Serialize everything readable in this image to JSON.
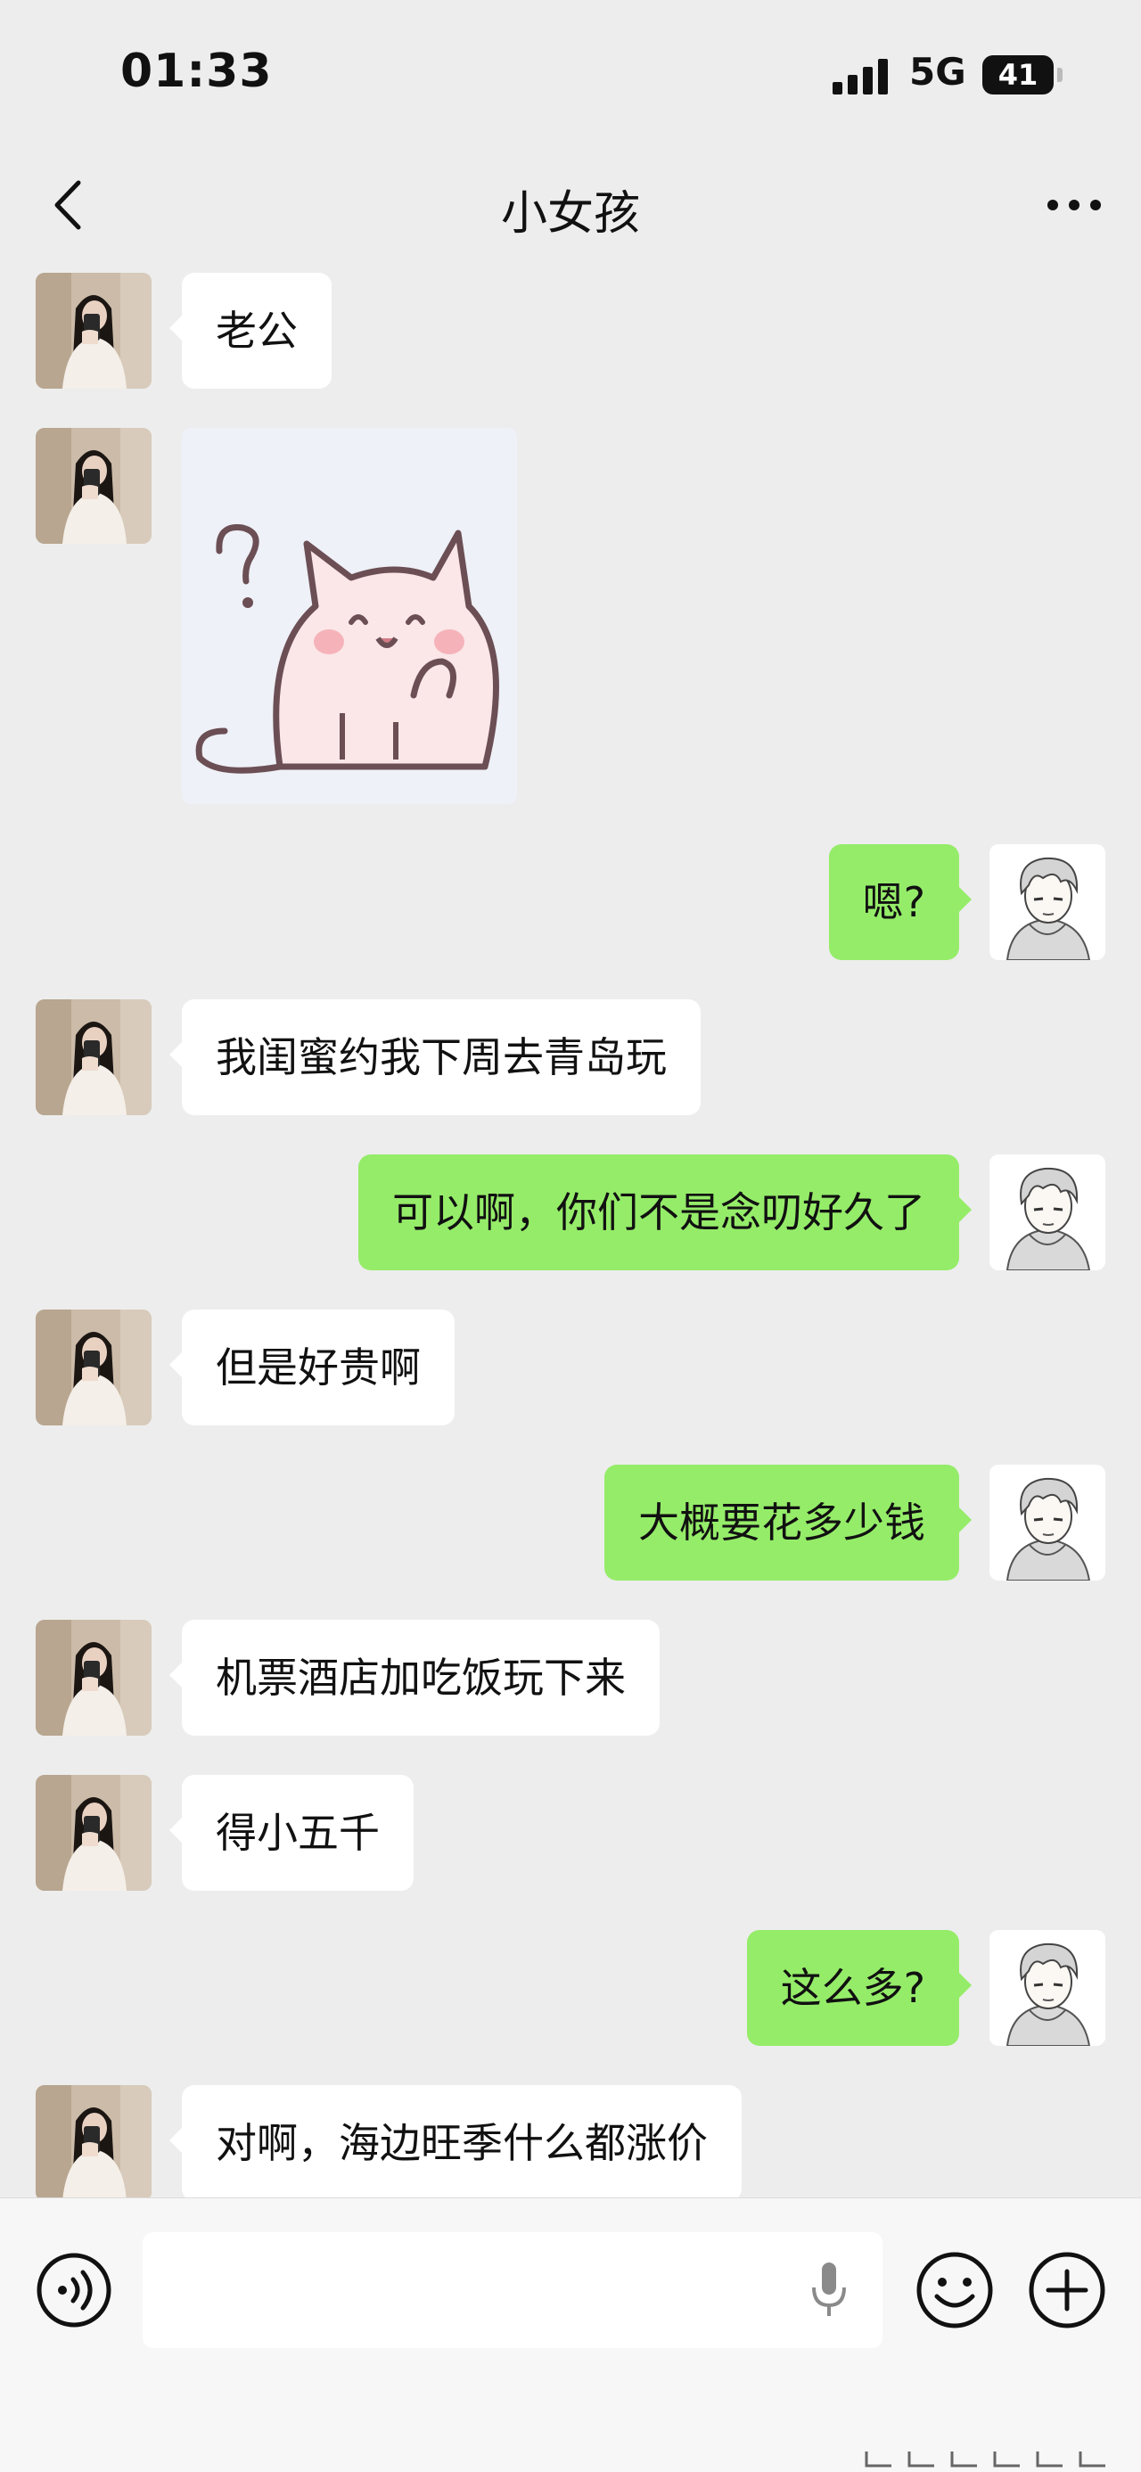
{
  "status": {
    "time": "01:33",
    "network": "5G",
    "battery": "41"
  },
  "header": {
    "title": "小女孩"
  },
  "messages": [
    {
      "side": "in",
      "text": "老公"
    },
    {
      "side": "in",
      "type": "sticker",
      "icon": "cat-question-sticker"
    },
    {
      "side": "out",
      "text": "嗯?"
    },
    {
      "side": "in",
      "text": "我闺蜜约我下周去青岛玩"
    },
    {
      "side": "out",
      "text": "可以啊，你们不是念叨好久了"
    },
    {
      "side": "in",
      "text": "但是好贵啊"
    },
    {
      "side": "out",
      "text": "大概要花多少钱"
    },
    {
      "side": "in",
      "text": "机票酒店加吃饭玩下来"
    },
    {
      "side": "in",
      "text": "得小五千"
    },
    {
      "side": "out",
      "text": "这么多?"
    },
    {
      "side": "in",
      "text": "对啊，海边旺季什么都涨价"
    }
  ],
  "colors": {
    "background": "#ededed",
    "incoming": "#ffffff",
    "outgoing": "#95ec69"
  }
}
